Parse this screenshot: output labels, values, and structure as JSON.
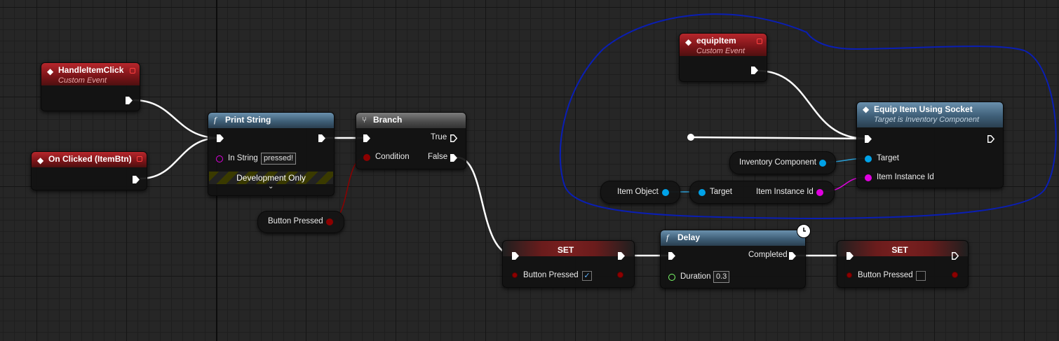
{
  "nodes": {
    "handle_item_click": {
      "title": "HandleItemClick",
      "subtitle": "Custom Event"
    },
    "on_clicked": {
      "title": "On Clicked (ItemBtn)"
    },
    "print_string": {
      "title": "Print String",
      "in_string_label": "In String",
      "in_string_value": "pressed!",
      "dev_only": "Development Only",
      "expand_icon": "chevron-down-icon"
    },
    "branch": {
      "title": "Branch",
      "true_label": "True",
      "condition_label": "Condition",
      "false_label": "False"
    },
    "button_pressed_getter": {
      "label": "Button Pressed"
    },
    "equip_item": {
      "title": "equipItem",
      "subtitle": "Custom Event"
    },
    "equip_item_socket": {
      "title": "Equip Item Using Socket",
      "subtitle": "Target is Inventory Component",
      "target_label": "Target",
      "instance_label": "Item Instance Id"
    },
    "inventory_component": {
      "label": "Inventory Component"
    },
    "item_object": {
      "label": "Item Object"
    },
    "get_instance_id": {
      "target_label": "Target",
      "output_label": "Item Instance Id"
    },
    "set_1": {
      "title": "SET",
      "var_label": "Button Pressed",
      "checked": true
    },
    "delay": {
      "title": "Delay",
      "completed_label": "Completed",
      "duration_label": "Duration",
      "duration_value": "0.3"
    },
    "set_2": {
      "title": "SET",
      "var_label": "Button Pressed",
      "checked": false
    }
  },
  "colors": {
    "event_header": "#b7272c",
    "function_header": "#4f7592",
    "bool_pin": "#8c0000",
    "object_pin": "#00a2e8",
    "string_pin": "#e000e0",
    "float_pin": "#7cff6a",
    "annotation": "#0a1eb4"
  }
}
